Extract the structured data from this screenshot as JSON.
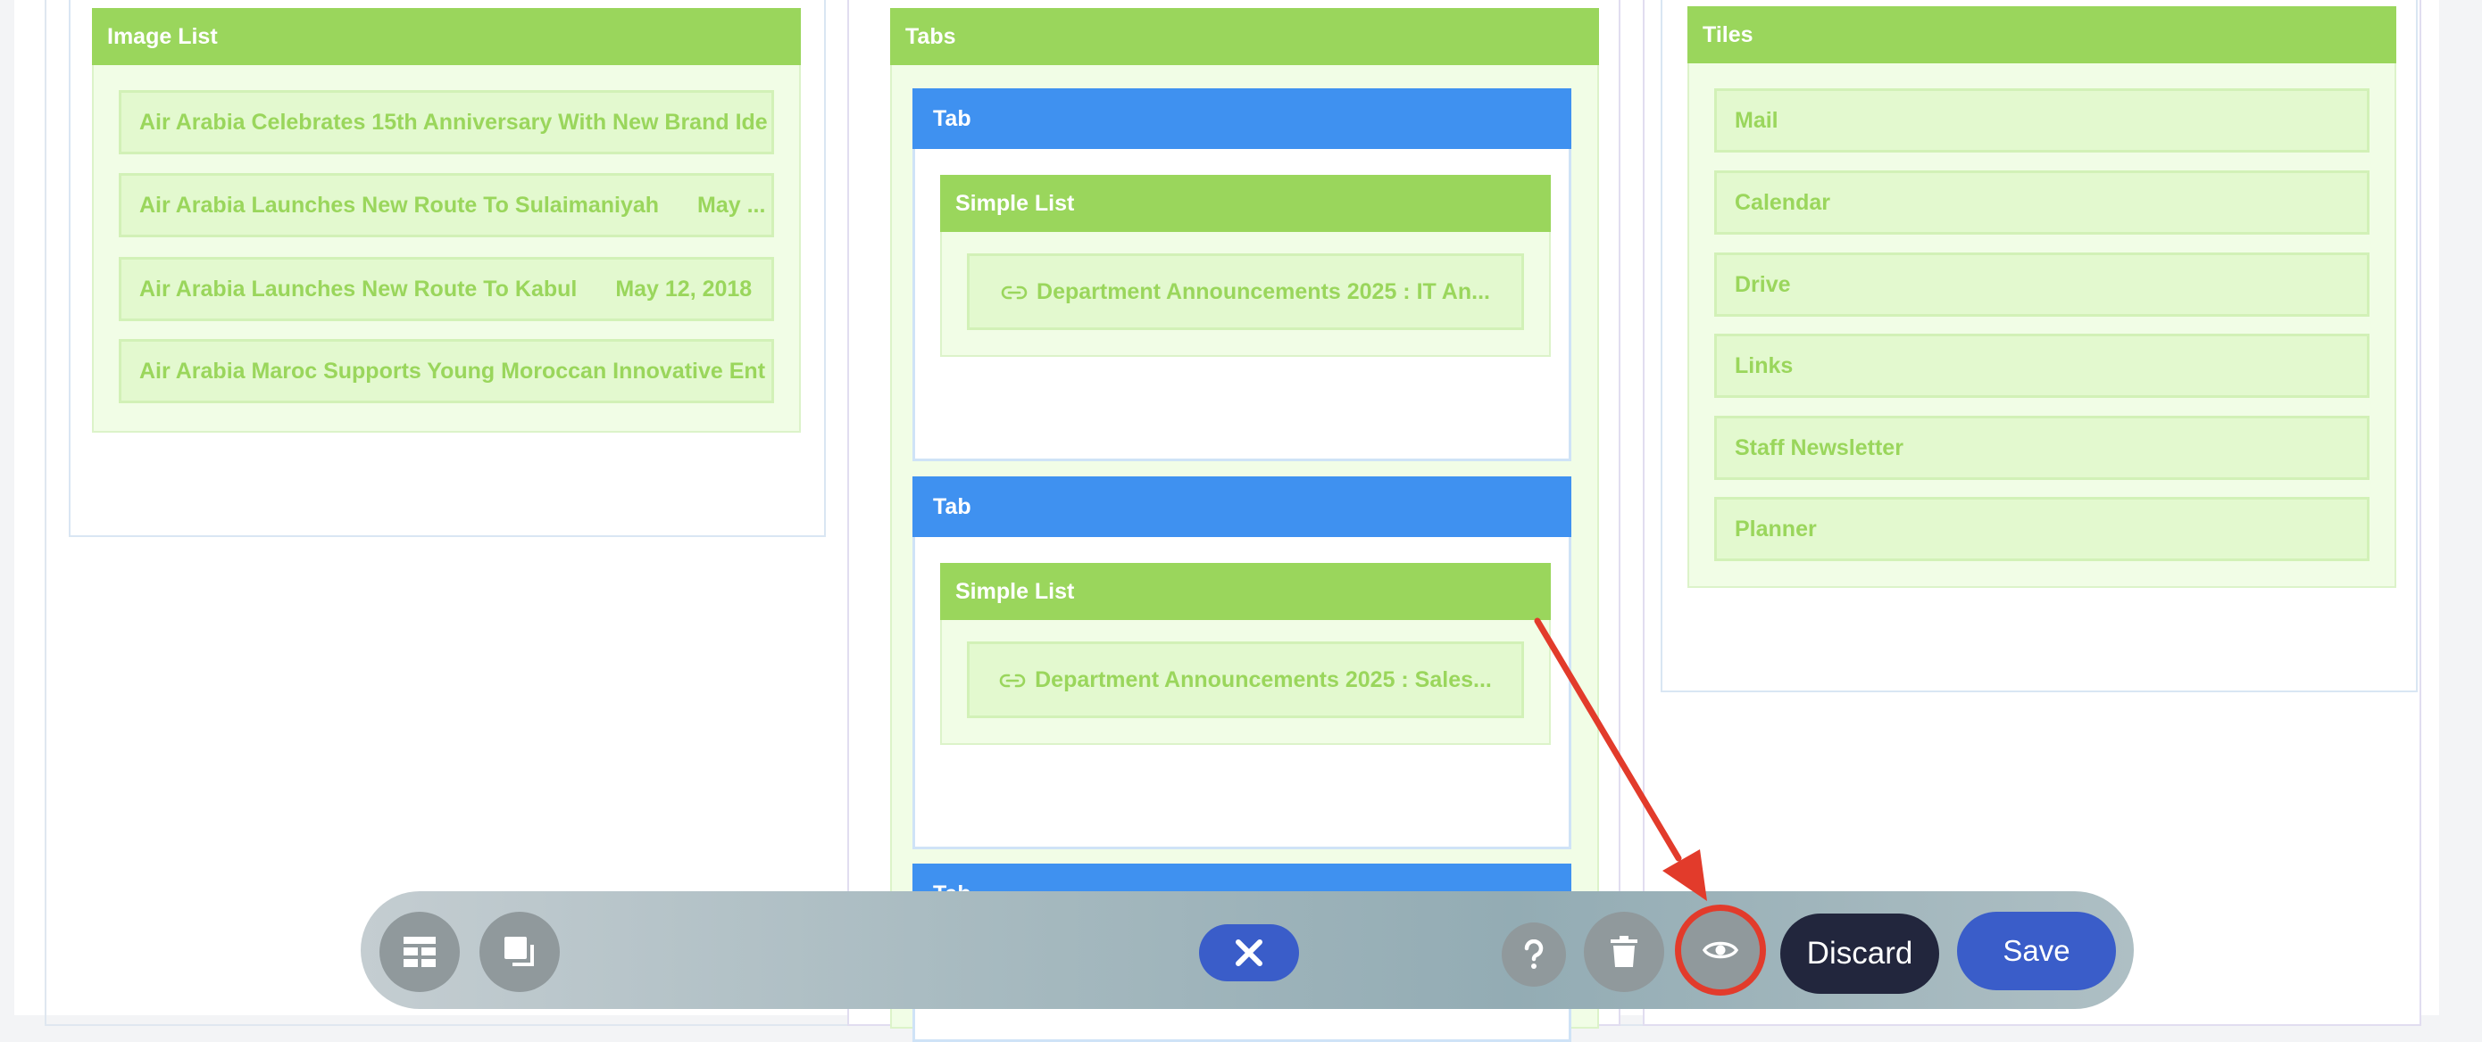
{
  "image_list": {
    "title": "Image List",
    "items": [
      {
        "title": "Air Arabia Celebrates 15th Anniversary With New Brand Ide",
        "date": ""
      },
      {
        "title": "Air Arabia Launches New Route To Sulaimaniyah",
        "date": "May ..."
      },
      {
        "title": "Air Arabia Launches New Route To Kabul",
        "date": "May 12, 2018"
      },
      {
        "title": "Air Arabia Maroc Supports Young Moroccan Innovative Ent",
        "date": ""
      }
    ]
  },
  "tabs": {
    "title": "Tabs",
    "tab_label": "Tab",
    "simple_list_label": "Simple List",
    "tab_items": [
      {
        "item": "Department Announcements 2025 : IT An..."
      },
      {
        "item": "Department Announcements 2025 : Sales..."
      }
    ],
    "third_tab_label": "Tab"
  },
  "tiles": {
    "title": "Tiles",
    "items": [
      "Mail",
      "Calendar",
      "Drive",
      "Links",
      "Staff Newsletter",
      "Planner"
    ]
  },
  "toolbar": {
    "discard_label": "Discard",
    "save_label": "Save",
    "icons": [
      "layout-icon",
      "duplicate-icon",
      "close-icon",
      "help-icon",
      "trash-icon",
      "eye-icon"
    ]
  },
  "colors": {
    "widget_header": "#9ad65c",
    "tab_header": "#3f91f0",
    "save_button": "#3a5dc9",
    "discard_button": "#22263d",
    "annotation": "#e23b2b"
  }
}
